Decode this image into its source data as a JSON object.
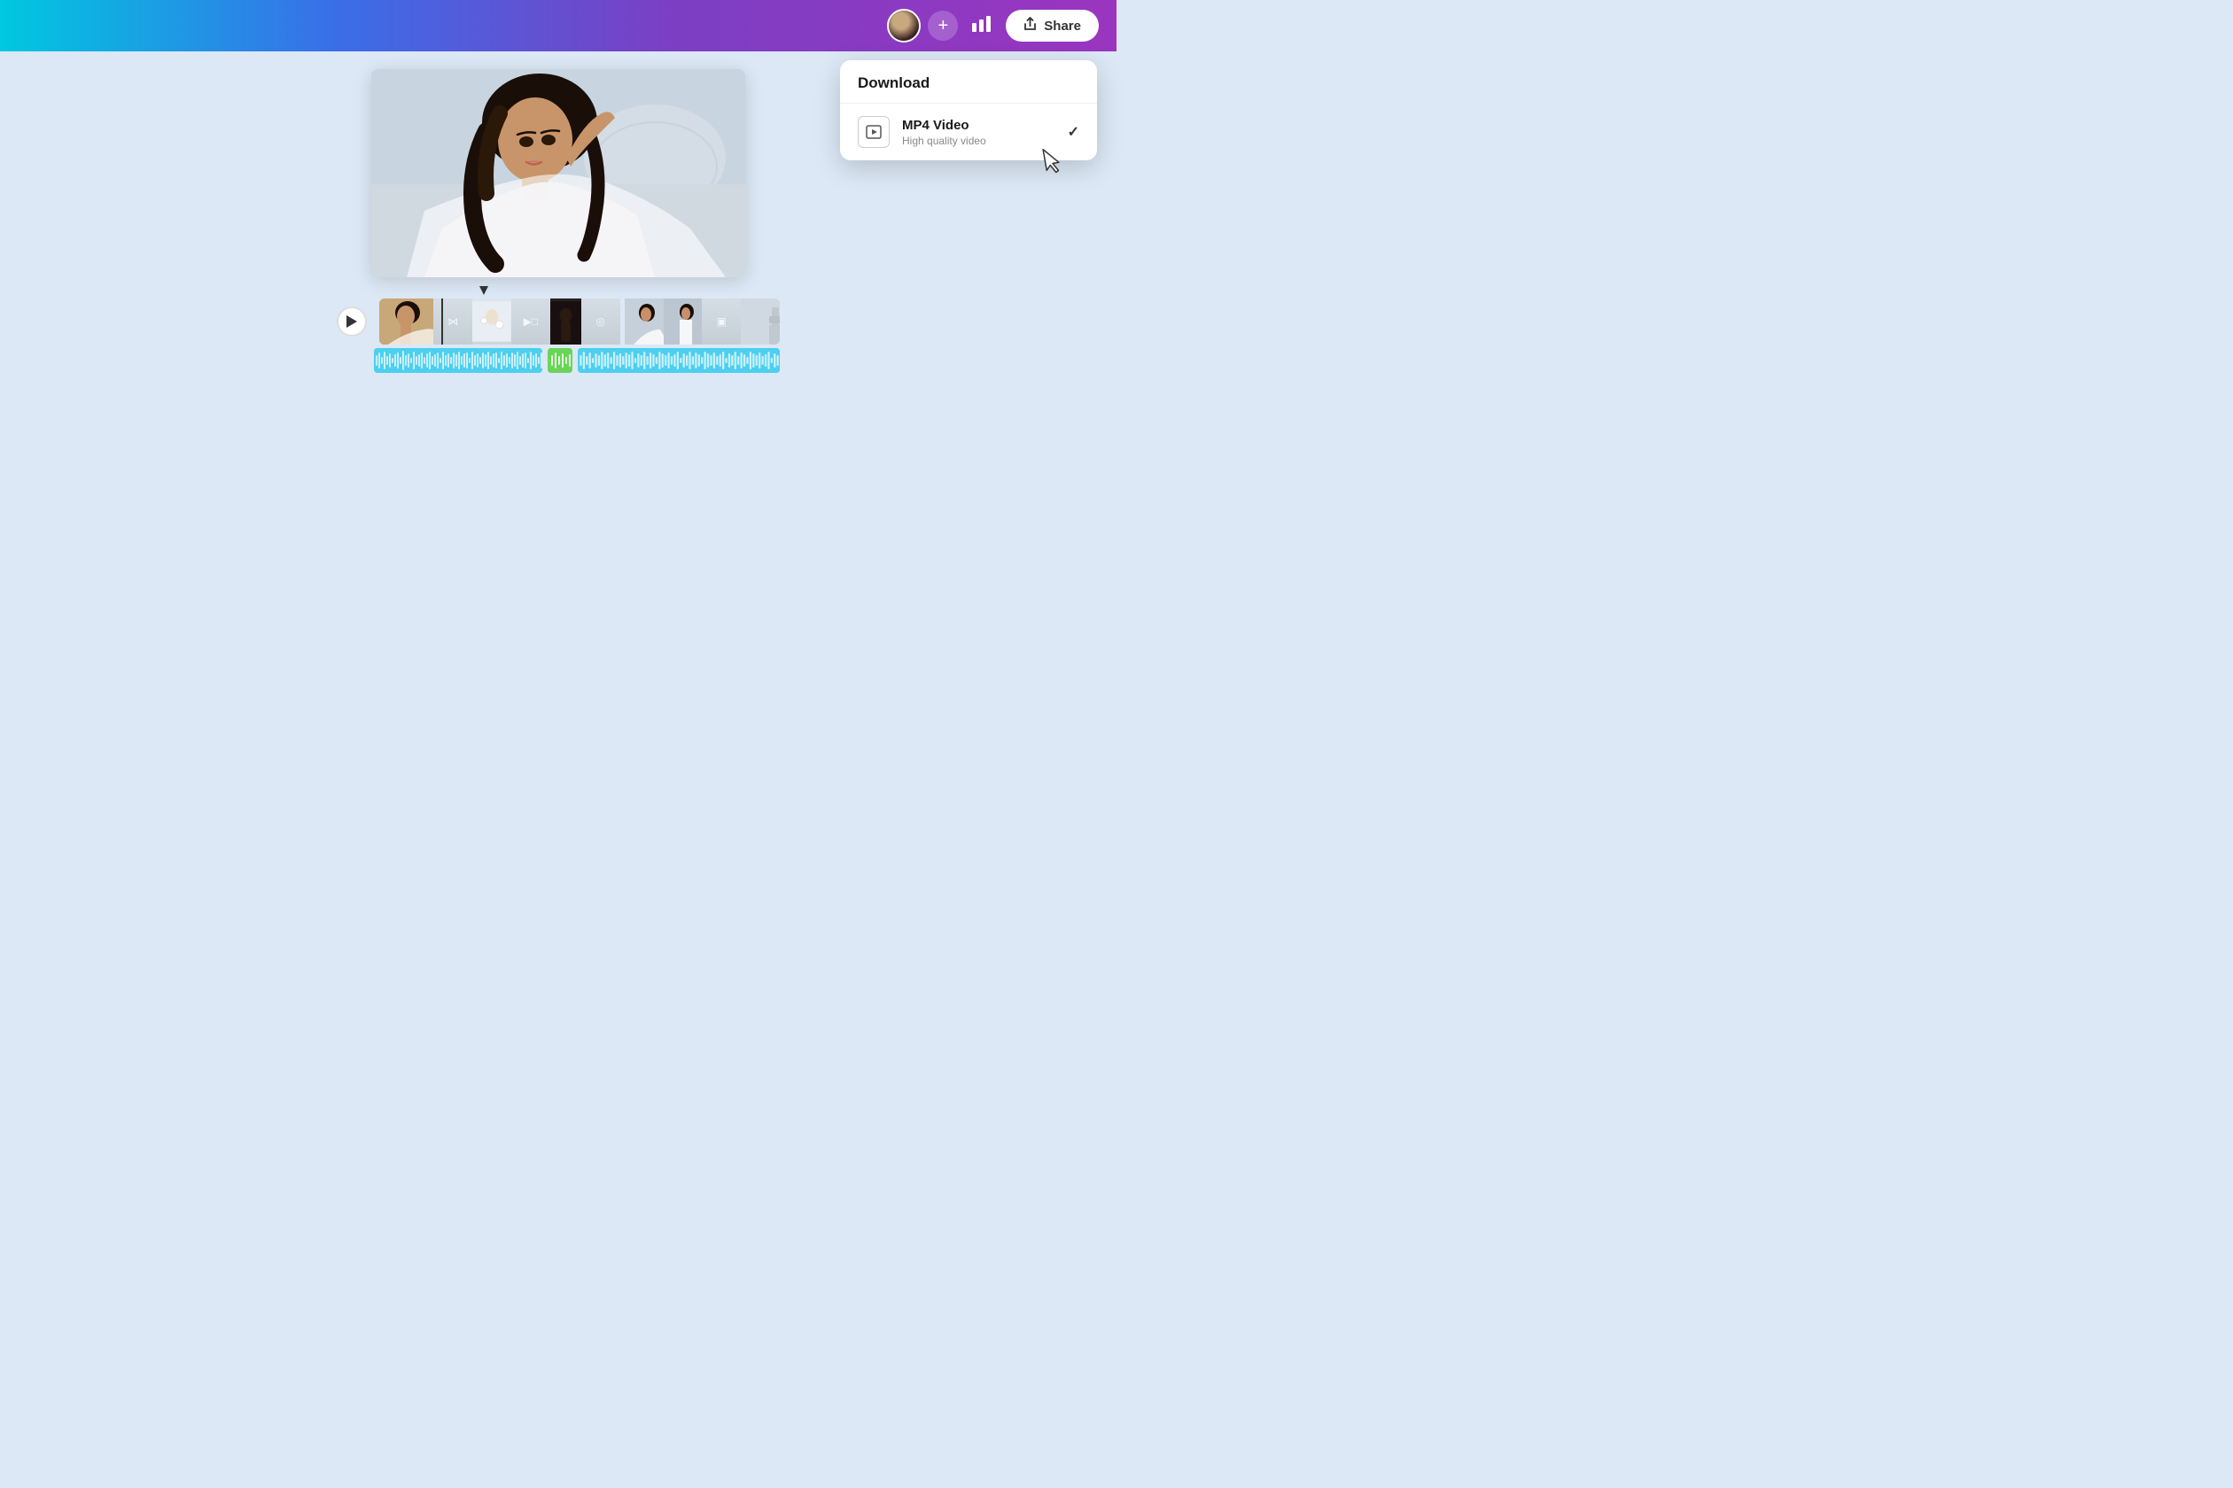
{
  "header": {
    "share_label": "Share",
    "add_label": "+"
  },
  "dropdown": {
    "title": "Download",
    "items": [
      {
        "id": "mp4",
        "name": "MP4 Video",
        "description": "High quality video",
        "selected": true,
        "icon": "▶"
      }
    ]
  },
  "video": {
    "preview_alt": "Video preview - woman with curly hair in white outfit"
  },
  "timeline": {
    "play_label": "Play"
  },
  "icons": {
    "share": "↑",
    "stats": "📊",
    "check": "✓",
    "play": "▶",
    "video": "▶",
    "transition1": "⋈",
    "transition2": "▶□",
    "transition3": "◎",
    "transition4": "▣"
  }
}
